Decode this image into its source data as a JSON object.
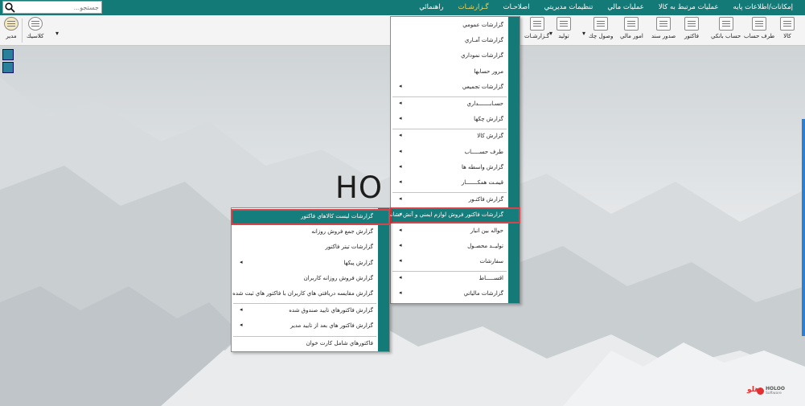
{
  "menubar": {
    "search_placeholder": "جستجو...",
    "items": [
      "إمكانات/اطلاعات پايه",
      "عمليات مرتبط به كالا",
      "عمليات مالي",
      "تنظيمات مديريتي",
      "اصلاحـات",
      "گـزارشـات",
      "راهنمائي"
    ],
    "active_index": 5
  },
  "toolbar": {
    "right_buttons": [
      "كالا",
      "طرف حساب",
      "حساب بانكي",
      "فاكتور",
      "صدور سند",
      "امور مالي",
      "وصول چك",
      "توليد",
      "گـزارشـات"
    ],
    "left_buttons": [
      "كلاسيك",
      "مدير"
    ]
  },
  "background_text": "HO",
  "main_menu": {
    "items": [
      {
        "label": "گزارشات عمومي",
        "arrow": false
      },
      {
        "label": "گزارشات آمـاري",
        "arrow": false
      },
      {
        "label": "گزارشات نموداري",
        "arrow": false
      },
      {
        "label": "مرور حسابها",
        "arrow": false
      },
      {
        "label": "گزارشات تجميعي",
        "arrow": true
      },
      {
        "label": "حسـابـــــــداري",
        "arrow": true
      },
      {
        "label": "گزارش چكها",
        "arrow": true
      },
      {
        "label": "گزارش كالا",
        "arrow": true
      },
      {
        "label": "طرف حســـــاب",
        "arrow": true
      },
      {
        "label": "گزارش واسطه ها",
        "arrow": true
      },
      {
        "label": "قيمـت همكـــــــار",
        "arrow": true
      },
      {
        "label": "گزارش فاكتـور",
        "arrow": true
      },
      {
        "label": "گزارشات فاكتور فروش لوازم ايمني و آتش نشاني",
        "arrow": true
      },
      {
        "label": "حواله بين انبار",
        "arrow": true
      },
      {
        "label": "توليــد محصـول",
        "arrow": true
      },
      {
        "label": "سفارشات",
        "arrow": true
      },
      {
        "label": "اقســـــاط",
        "arrow": true
      },
      {
        "label": "گزارشات مالياتي",
        "arrow": true
      }
    ],
    "highlighted_index": 12
  },
  "sub_menu": {
    "items": [
      {
        "label": "گزارشات ليست كالاهاي فاكتور",
        "arrow": false
      },
      {
        "label": "گزارش جمع فروش روزانه",
        "arrow": false
      },
      {
        "label": "گزارشات تيتر فاكتور",
        "arrow": false
      },
      {
        "label": "گزارش پيكها",
        "arrow": true
      },
      {
        "label": "گزارش فروش روزانه كاربران",
        "arrow": false
      },
      {
        "label": "گزارش مقايسه دريافتي هاي  كاربران با فاكتور هاي ثبت شده",
        "arrow": false
      },
      {
        "label": "گزارش فاكتورهاي تاييد صندوق شده",
        "arrow": true
      },
      {
        "label": "گزارش فاكتور هاي بعد از تاييد مدير",
        "arrow": true
      },
      {
        "label": "فاكتورهاي شامل كارت خوان",
        "arrow": false
      }
    ],
    "highlighted_index": 0
  },
  "logo": {
    "fa": "هلو",
    "en": "HOLOO",
    "sub": "Software"
  }
}
